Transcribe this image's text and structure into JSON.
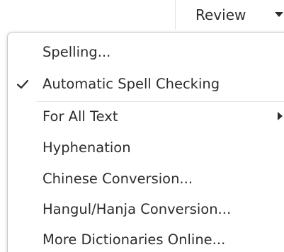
{
  "toolbar": {
    "review_label": "Review"
  },
  "menu": {
    "items": [
      {
        "label": "Spelling..."
      },
      {
        "label": "Automatic Spell Checking",
        "checked": true
      },
      {
        "label": "For All Text",
        "has_submenu": true
      },
      {
        "label": "Hyphenation"
      },
      {
        "label": "Chinese Conversion..."
      },
      {
        "label": "Hangul/Hanja Conversion..."
      },
      {
        "label": "More Dictionaries Online..."
      }
    ]
  }
}
